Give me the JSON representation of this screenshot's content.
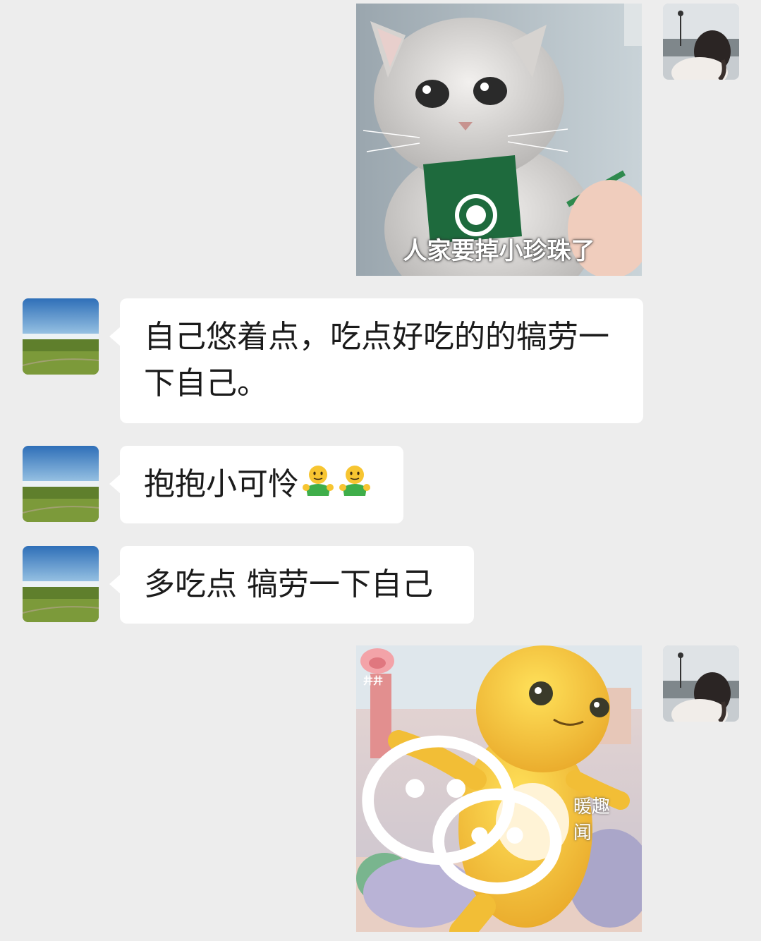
{
  "messages": [
    {
      "id": "m1",
      "side": "right",
      "type": "image",
      "sticker": "sad-cat-sticker",
      "caption": "人家要掉小珍珠了"
    },
    {
      "id": "m2",
      "side": "left",
      "type": "text",
      "text": "自己悠着点，吃点好吃的的犒劳一下自己。"
    },
    {
      "id": "m3",
      "side": "left",
      "type": "text",
      "text": "抱抱小可怜",
      "emojis": [
        "hug-emoji",
        "hug-emoji"
      ]
    },
    {
      "id": "m4",
      "side": "left",
      "type": "text",
      "text": "多吃点 犒劳一下自己"
    },
    {
      "id": "m5",
      "side": "right",
      "type": "image",
      "sticker": "yellow-creature-sticker",
      "badge": "井井"
    }
  ],
  "avatars": {
    "self": "girl-photo-avatar",
    "contact": "grassland-landscape-avatar"
  },
  "watermark": {
    "icon": "wechat-icon",
    "label": "暖趣闻"
  },
  "colors": {
    "background": "#ededed",
    "bubble": "#ffffff",
    "text": "#1b1b1b"
  }
}
